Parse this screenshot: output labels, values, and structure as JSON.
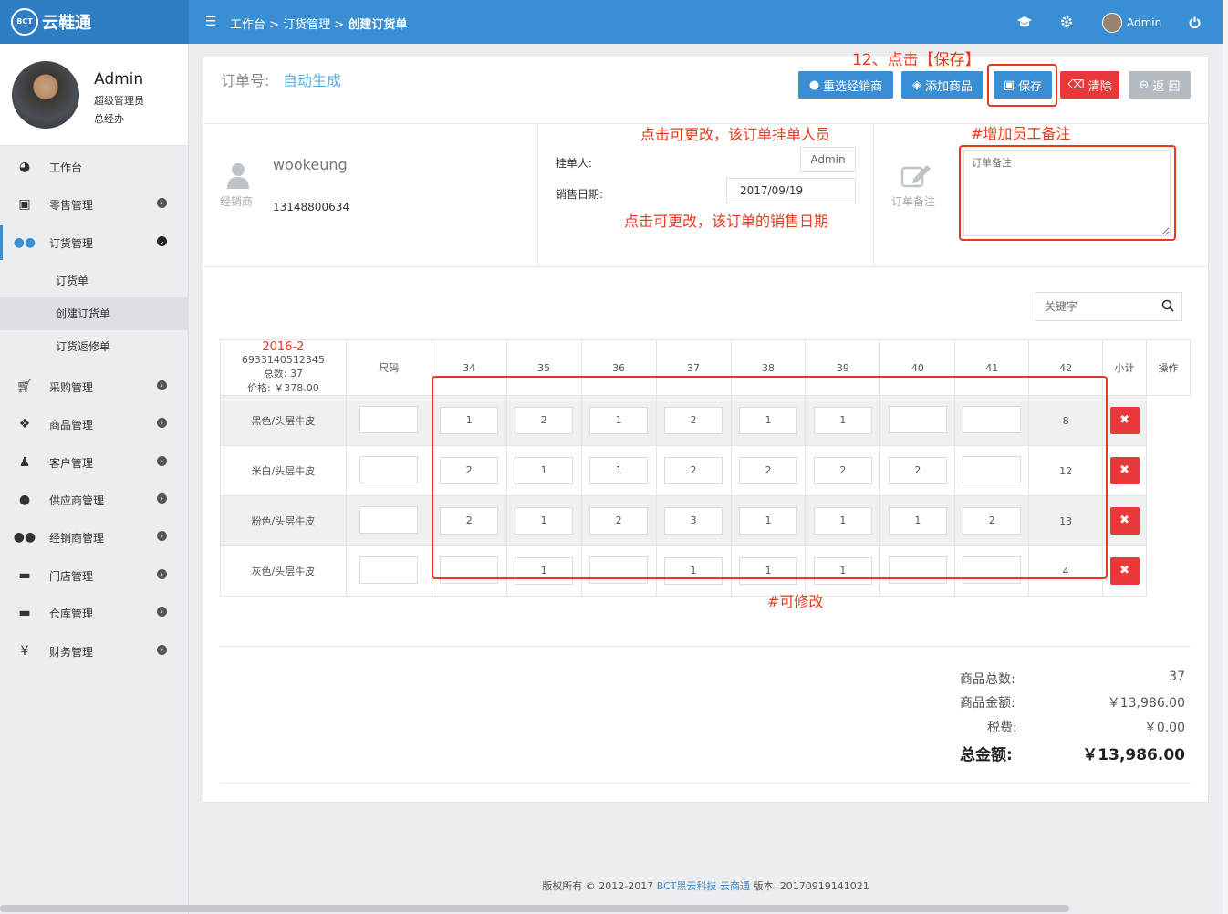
{
  "header": {
    "logo_badge": "BCT",
    "logo_text": "云鞋通",
    "menu_icon": "☰",
    "breadcrumb": [
      "工作台",
      "订货管理",
      "创建订货单"
    ],
    "user": "Admin"
  },
  "profile": {
    "name": "Admin",
    "role": "超级管理员",
    "dept": "总经办"
  },
  "sidebar": {
    "items": [
      {
        "label": "工作台",
        "icon": "dashboard-icon"
      },
      {
        "label": "零售管理",
        "icon": "money-icon"
      },
      {
        "label": "订货管理",
        "icon": "users-icon"
      },
      {
        "label": "采购管理",
        "icon": "cart-icon"
      },
      {
        "label": "商品管理",
        "icon": "cubes-icon"
      },
      {
        "label": "客户管理",
        "icon": "person-icon"
      },
      {
        "label": "供应商管理",
        "icon": "user-icon"
      },
      {
        "label": "经销商管理",
        "icon": "group-icon"
      },
      {
        "label": "门店管理",
        "icon": "store-icon"
      },
      {
        "label": "仓库管理",
        "icon": "archive-icon"
      },
      {
        "label": "财务管理",
        "icon": "yen-icon"
      }
    ],
    "sub": [
      "订货单",
      "创建订货单",
      "订货返修单"
    ]
  },
  "order": {
    "no_label": "订单号:",
    "no_value": "自动生成"
  },
  "buttons": {
    "reselect": "重选经销商",
    "add": "添加商品",
    "save": "保存",
    "clear": "清除",
    "back": "返 回"
  },
  "annotations": {
    "save": "12、点击【保存】",
    "person": "点击可更改，该订单挂单人员",
    "date": "点击可更改，该订单的销售日期",
    "remark": "#增加员工备注",
    "editable": "#可修改"
  },
  "dealer": {
    "label": "经销商",
    "name": "wookeung",
    "phone": "13148800634"
  },
  "form": {
    "person_label": "挂单人:",
    "person_value": "Admin",
    "date_label": "销售日期:",
    "date_value": "2017/09/19",
    "remark_label": "订单备注",
    "remark_placeholder": "订单备注"
  },
  "search": {
    "placeholder": "关键字"
  },
  "table": {
    "size_label": "尺码",
    "sizes": [
      "34",
      "35",
      "36",
      "37",
      "38",
      "39",
      "40",
      "41",
      "42"
    ],
    "subtotal_label": "小计",
    "op_label": "操作",
    "product": {
      "code": "2016-2",
      "barcode": "6933140512345",
      "total": "总数: 37",
      "price": "价格: ￥378.00"
    },
    "rows": [
      {
        "color": "黑色/头层牛皮",
        "qty": [
          "",
          "1",
          "2",
          "1",
          "2",
          "1",
          "1",
          "",
          ""
        ],
        "subtotal": "8"
      },
      {
        "color": "米白/头层牛皮",
        "qty": [
          "",
          "2",
          "1",
          "1",
          "2",
          "2",
          "2",
          "2",
          ""
        ],
        "subtotal": "12"
      },
      {
        "color": "粉色/头层牛皮",
        "qty": [
          "",
          "2",
          "1",
          "2",
          "3",
          "1",
          "1",
          "1",
          "2"
        ],
        "subtotal": "13"
      },
      {
        "color": "灰色/头层牛皮",
        "qty": [
          "",
          "",
          "1",
          "",
          "1",
          "1",
          "1",
          "",
          ""
        ],
        "subtotal": "4"
      }
    ]
  },
  "summary": {
    "count_label": "商品总数:",
    "count": "37",
    "amount_label": "商品金额:",
    "amount": "￥13,986.00",
    "tax_label": "税费:",
    "tax": "￥0.00",
    "total_label": "总金额:",
    "total": "￥13,986.00"
  },
  "footer": {
    "copy": "版权所有 © 2012-2017",
    "company": "BCT黑云科技",
    "product": "云商通",
    "version": "版本: 20170919141021"
  }
}
